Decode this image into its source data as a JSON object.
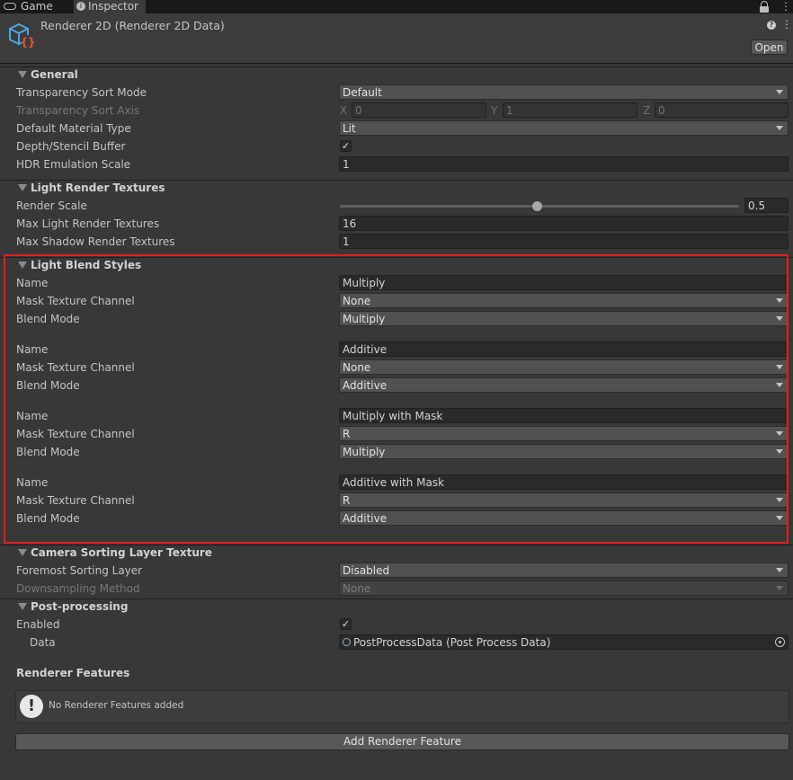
{
  "tabs": [
    {
      "label": "Game",
      "icon": "gamepad-icon"
    },
    {
      "label": "Inspector",
      "icon": "info-icon"
    }
  ],
  "header": {
    "title": "Renderer 2D (Renderer 2D Data)",
    "open_label": "Open"
  },
  "general": {
    "title": "General",
    "transparency_sort_mode": {
      "label": "Transparency Sort Mode",
      "value": "Default"
    },
    "transparency_sort_axis": {
      "label": "Transparency Sort Axis",
      "x_label": "X",
      "x": "0",
      "y_label": "Y",
      "y": "1",
      "z_label": "Z",
      "z": "0"
    },
    "default_material_type": {
      "label": "Default Material Type",
      "value": "Lit"
    },
    "depth_stencil": {
      "label": "Depth/Stencil Buffer",
      "check": "✓"
    },
    "hdr_emulation_scale": {
      "label": "HDR Emulation Scale",
      "value": "1"
    }
  },
  "light_render_textures": {
    "title": "Light Render Textures",
    "render_scale": {
      "label": "Render Scale",
      "value": "0.5"
    },
    "max_light": {
      "label": "Max Light Render Textures",
      "value": "16"
    },
    "max_shadow": {
      "label": "Max Shadow Render Textures",
      "value": "1"
    }
  },
  "light_blend_styles": {
    "title": "Light Blend Styles",
    "labels": {
      "name": "Name",
      "mask": "Mask Texture Channel",
      "blend": "Blend Mode"
    },
    "styles": [
      {
        "name": "Multiply",
        "mask": "None",
        "blend": "Multiply"
      },
      {
        "name": "Additive",
        "mask": "None",
        "blend": "Additive"
      },
      {
        "name": "Multiply with Mask",
        "mask": "R",
        "blend": "Multiply"
      },
      {
        "name": "Additive with Mask",
        "mask": "R",
        "blend": "Additive"
      }
    ]
  },
  "camera_sorting": {
    "title": "Camera Sorting Layer Texture",
    "foremost": {
      "label": "Foremost Sorting Layer",
      "value": "Disabled"
    },
    "downsampling": {
      "label": "Downsampling Method",
      "value": "None"
    }
  },
  "post_processing": {
    "title": "Post-processing",
    "enabled": {
      "label": "Enabled",
      "check": "✓"
    },
    "data": {
      "label": "Data",
      "value": "PostProcessData (Post Process Data)"
    }
  },
  "renderer_features": {
    "title": "Renderer Features",
    "help_icon": "!",
    "empty_text": "No Renderer Features added",
    "add_label": "Add Renderer Feature"
  },
  "colors": {
    "highlight": "#e0201e",
    "background": "#383838",
    "field": "#2a2a2a",
    "dropdown": "#515151"
  }
}
